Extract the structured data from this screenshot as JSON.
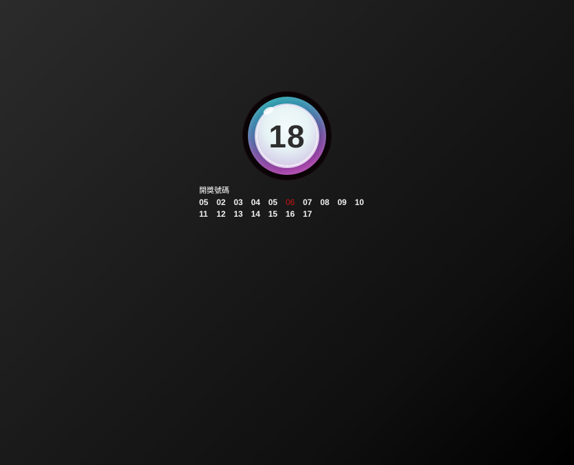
{
  "ball": {
    "number": "18",
    "icon": "lottery-ball"
  },
  "draw_panel": {
    "title": "開獎號碼",
    "rows": [
      [
        "05",
        "02",
        "03",
        "04",
        "05",
        "06",
        "07",
        "08",
        "09",
        "10"
      ],
      [
        "11",
        "12",
        "13",
        "14",
        "15",
        "16",
        "17"
      ]
    ],
    "highlighted": "06",
    "highlight_color": "#c81414",
    "number_color": "#f0f0f0"
  }
}
